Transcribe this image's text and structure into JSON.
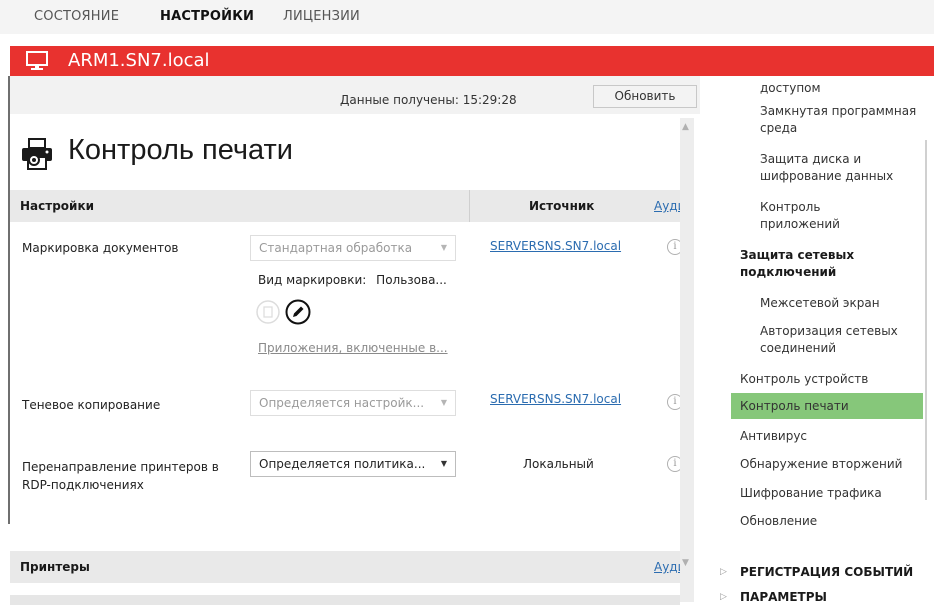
{
  "top_tabs": [
    {
      "label": "СОСТОЯНИЕ",
      "active": false
    },
    {
      "label": "НАСТРОЙКИ",
      "active": true
    },
    {
      "label": "ЛИЦЕНЗИИ",
      "active": false
    }
  ],
  "host": {
    "name": "ARM1.SN7.local",
    "icon": "monitor-icon"
  },
  "header_info": {
    "data_received_label": "Данные получены:",
    "data_received_time": "15:29:28",
    "refresh_label": "Обновить"
  },
  "page": {
    "title": "Контроль печати",
    "icon": "printer-icon"
  },
  "settings_section": {
    "title": "Настройки",
    "source_header": "Источник",
    "audit_link": "Аудит"
  },
  "settings_rows": [
    {
      "label": "Маркировка документов",
      "value": "Стандартная обработка",
      "source": "SERVERSNS.SN7.local",
      "marking_kind_label": "Вид маркировки:",
      "marking_kind_value": "Пользова...",
      "apps_link": "Приложения, включенные в..."
    },
    {
      "label": "Теневое копирование",
      "value": "Определяется настройк...",
      "source": "SERVERSNS.SN7.local"
    },
    {
      "label": "Перенаправление принтеров в RDP-подключениях",
      "value": "Определяется политика...",
      "source": "Локальный"
    }
  ],
  "printers_section": {
    "title": "Принтеры",
    "audit_link": "Аудит"
  },
  "sidebar": {
    "items": [
      {
        "label": "доступом",
        "bold": false,
        "indent": 2
      },
      {
        "label": "Замкнутая программная среда",
        "bold": false,
        "indent": 2
      },
      {
        "label": "Защита диска и шифрование данных",
        "bold": false,
        "indent": 2
      },
      {
        "label": "Контроль приложений",
        "bold": false,
        "indent": 2
      },
      {
        "label": "Защита сетевых подключений",
        "bold": true,
        "indent": 1
      },
      {
        "label": "Межсетевой экран",
        "bold": false,
        "indent": 2
      },
      {
        "label": "Авторизация сетевых соединений",
        "bold": false,
        "indent": 2
      },
      {
        "label": "Контроль устройств",
        "bold": false,
        "indent": 1
      },
      {
        "label": "Контроль печати",
        "bold": false,
        "indent": 1,
        "active": true
      },
      {
        "label": "Антивирус",
        "bold": false,
        "indent": 1
      },
      {
        "label": "Обнаружение вторжений",
        "bold": false,
        "indent": 1
      },
      {
        "label": "Шифрование трафика",
        "bold": false,
        "indent": 1
      },
      {
        "label": "Обновление",
        "bold": false,
        "indent": 1
      }
    ],
    "groups": [
      {
        "label": "РЕГИСТРАЦИЯ СОБЫТИЙ"
      },
      {
        "label": "ПАРАМЕТРЫ"
      }
    ]
  },
  "colors": {
    "accent_red": "#e8322f",
    "active_green": "#86c77a",
    "link_blue": "#2b6cb0"
  }
}
